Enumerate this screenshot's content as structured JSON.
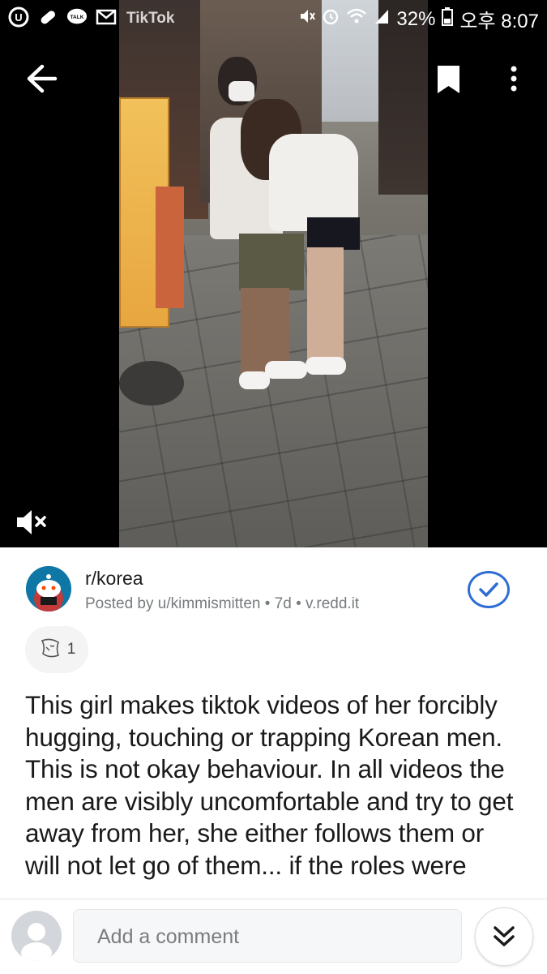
{
  "status_bar": {
    "battery": "32%",
    "time": "오후 8:07",
    "left_icons": [
      "u-plus-icon",
      "pill-icon",
      "talk-icon",
      "mail-icon",
      "image-icon"
    ],
    "right_icons": [
      "mute-icon",
      "alarm-icon",
      "wifi-icon",
      "signal-icon",
      "battery-icon"
    ]
  },
  "video": {
    "watermark": "TikTok",
    "icons": [
      "back-arrow-icon",
      "bookmark-icon",
      "more-icon",
      "mute-icon"
    ]
  },
  "post": {
    "subreddit": "r/korea",
    "meta": "Posted by u/kimmismitten • 7d • v.redd.it",
    "award_count": "1",
    "body": "This girl makes tiktok videos of her forcibly hugging, touching or trapping Korean men. This is not okay behaviour. In all videos the men are visibly uncomfortable and try to get away from her, she either follows them or will not let go of them... if the roles were"
  },
  "comment_bar": {
    "placeholder": "Add a comment"
  },
  "colors": {
    "accent_blue": "#2e6dd4",
    "meta_gray": "#787c7e",
    "text": "#1a1a1b"
  }
}
